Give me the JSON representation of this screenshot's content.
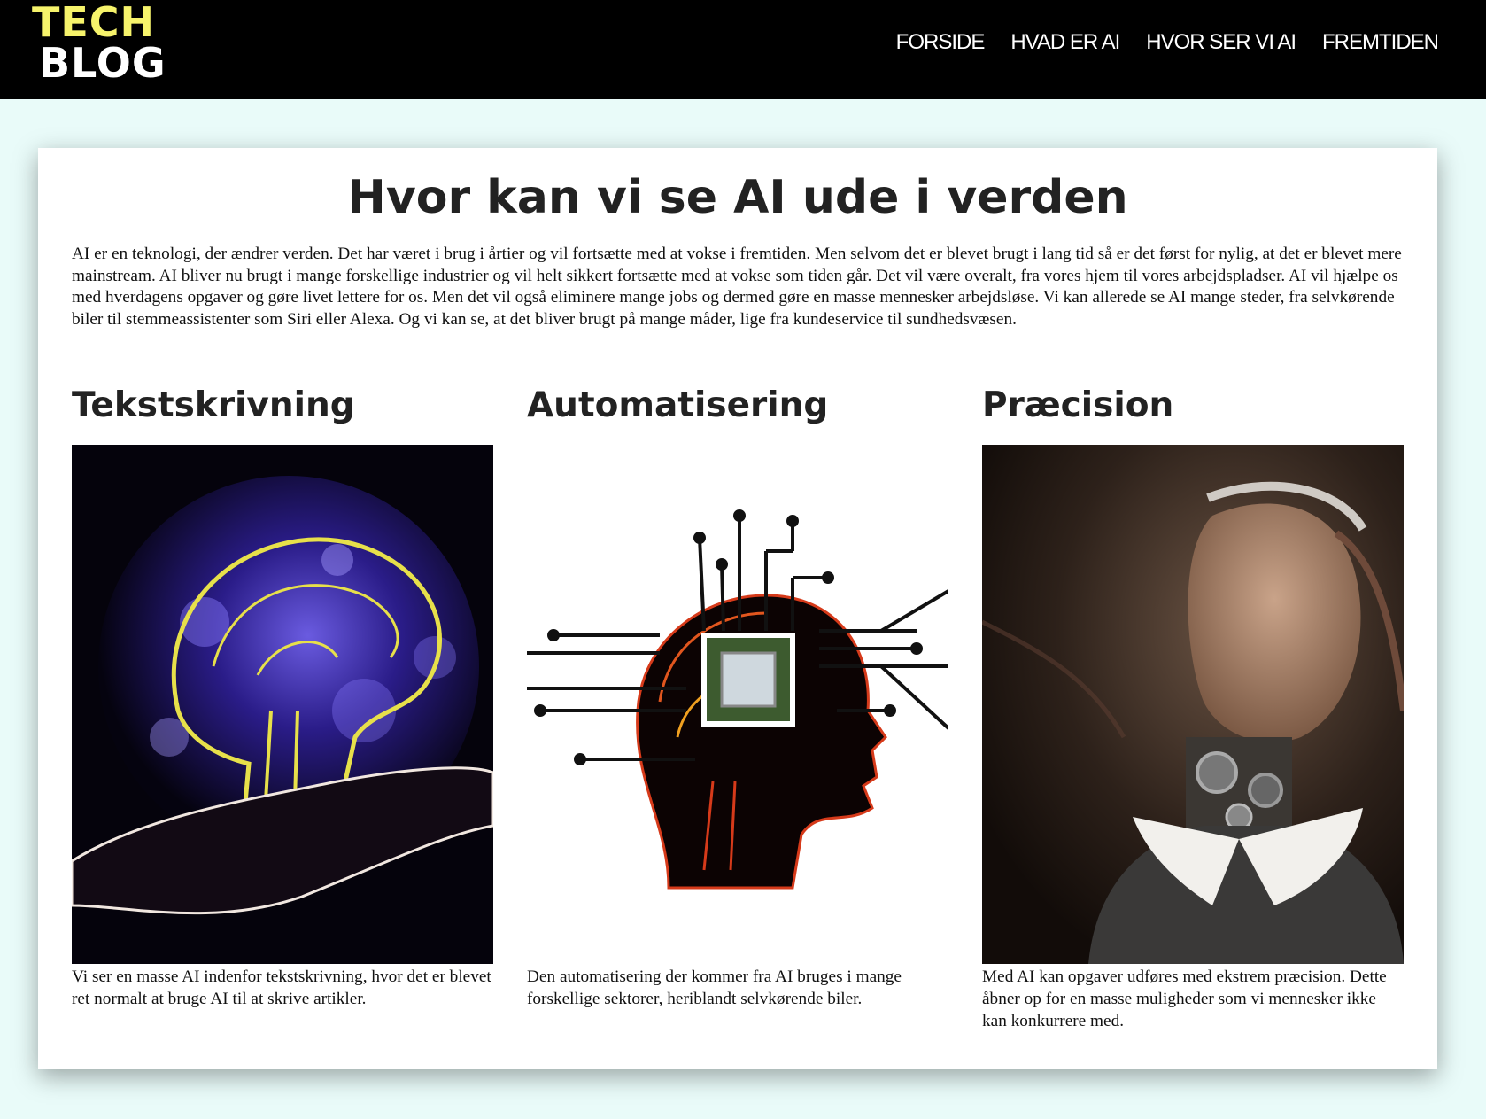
{
  "header": {
    "logo": {
      "line1": "TECH",
      "line2": "BLOG"
    },
    "nav": [
      {
        "label": "FORSIDE"
      },
      {
        "label": "HVAD ER AI"
      },
      {
        "label": "HVOR SER VI AI"
      },
      {
        "label": "FREMTIDEN"
      }
    ]
  },
  "main": {
    "title": "Hvor kan vi se AI ude i verden",
    "intro": "AI er en teknologi, der ændrer verden. Det har været i brug i årtier og vil fortsætte med at vokse i fremtiden. Men selvom det er blevet brugt i lang tid så er det først for nylig, at det er blevet mere mainstream. AI bliver nu brugt i mange forskellige industrier og vil helt sikkert fortsætte med at vokse som tiden går. Det vil være overalt, fra vores hjem til vores arbejdspladser. AI vil hjælpe os med hverdagens opgaver og gøre livet lettere for os. Men det vil også eliminere mange jobs og dermed gøre en masse mennesker arbejdsløse. Vi kan allerede se AI mange steder, fra selvkørende biler til stemmeassistenter som Siri eller Alexa. Og vi kan se, at det bliver brugt på mange måder, lige fra kundeservice til sundhedsvæsen.",
    "sections": [
      {
        "heading": "Tekstskrivning",
        "image": "brain-hand-illustration",
        "text": "Vi ser en masse AI indenfor tekstskrivning, hvor det er blevet ret normalt at bruge AI til at skrive artikler."
      },
      {
        "heading": "Automatisering",
        "image": "chip-head-circuit-illustration",
        "text": "Den automatisering der kommer fra AI bruges i mange forskellige sektorer, heriblandt selvkørende biler."
      },
      {
        "heading": "Præcision",
        "image": "android-woman-portrait",
        "text": "Med AI kan opgaver udføres med ekstrem præcision. Dette åbner op for en masse muligheder som vi mennesker ikke kan konkurrere med."
      }
    ]
  },
  "colors": {
    "topbar": "#000000",
    "logo_accent": "#f6f36b",
    "page_bg": "#e9fbf9",
    "card": "#ffffff"
  }
}
